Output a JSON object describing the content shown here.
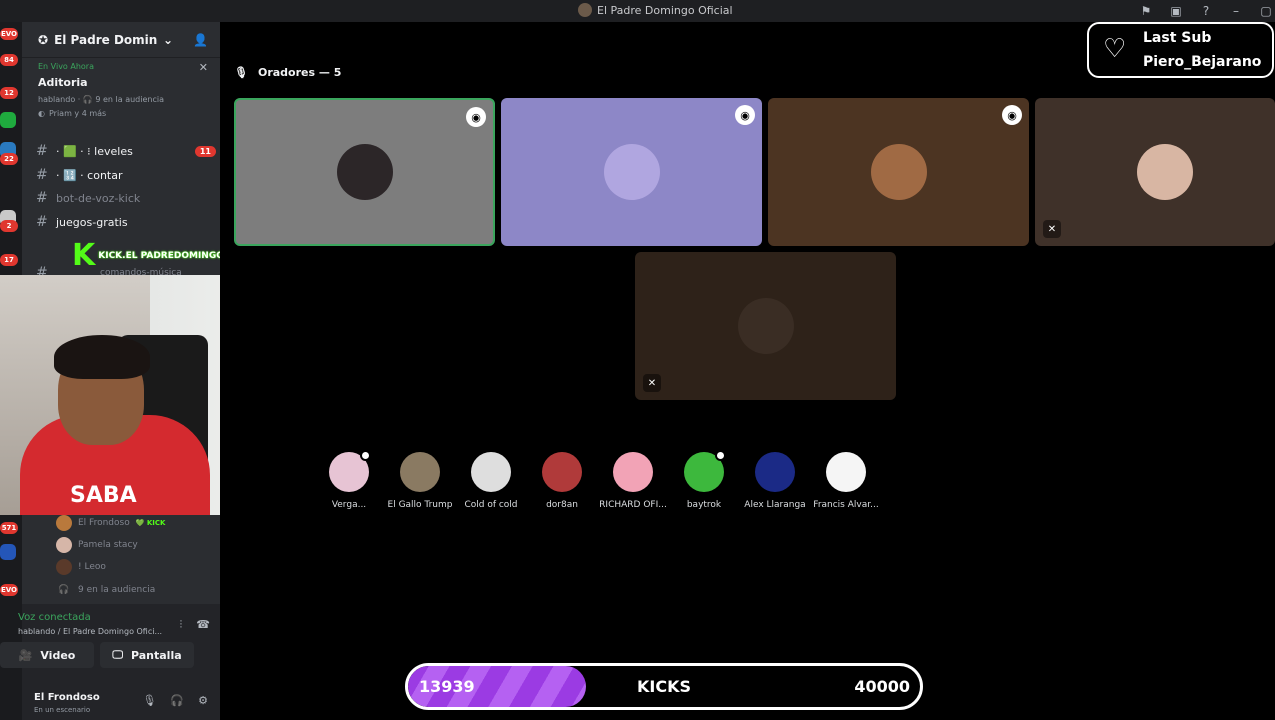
{
  "window": {
    "title": "El Padre Domingo Oficial"
  },
  "titlebar_icons": [
    "flag-icon",
    "inbox-icon",
    "help-icon",
    "minimize-icon",
    "maximize-icon"
  ],
  "rail_badges": [
    "EVO",
    "84",
    "12",
    "22",
    "2",
    "17",
    "571",
    "EVO"
  ],
  "server": {
    "name": "El Padre Domingo O..."
  },
  "live": {
    "tag": "En Vivo Ahora",
    "title": "Aditoria",
    "meta": "hablando · 🎧 9 en la audiencia",
    "people": "Priam y 4 más"
  },
  "channels": [
    {
      "label": "· 🟩 · ⁝ leveles",
      "badge": "11"
    },
    {
      "label": "· 🔢 · contar",
      "badge": ""
    },
    {
      "label": "bot-de-voz-kick",
      "badge": ""
    },
    {
      "label": "juegos-gratis",
      "badge": ""
    },
    {
      "label": "comandos-música",
      "badge": ""
    }
  ],
  "kick_overlay": {
    "letter": "K",
    "handle": "KICK.EL PADREDOMINGOOFICIAL"
  },
  "voice_users": [
    {
      "name": "El Frondoso",
      "tag": "💚 KICK",
      "right": ""
    },
    {
      "name": "Pamela stacy",
      "tag": "",
      "right": "✕"
    },
    {
      "name": "! Leoo",
      "tag": "",
      "right": "✕"
    }
  ],
  "audience_line": "9 en la audiencia",
  "voice_panel": {
    "status": "Voz conectada",
    "sub": "hablando / El Padre Domingo Ofici...",
    "video_label": "Video",
    "screen_label": "Pantalla"
  },
  "user": {
    "name": "El Frondoso",
    "status": "En un escenario"
  },
  "webcam_text": "SABA",
  "speakers": {
    "label": "Oradores — 5"
  },
  "speaker_tiles": [
    {
      "bg": "#7d7d7d",
      "avatar": "#2c2628",
      "stage": true,
      "muted": false,
      "active": true
    },
    {
      "bg": "#8d87c7",
      "avatar": "#b0a6e0",
      "stage": true,
      "muted": false,
      "active": false
    },
    {
      "bg": "#4c3422",
      "avatar": "#a06a44",
      "stage": true,
      "muted": false,
      "active": false
    },
    {
      "bg": "#3f3129",
      "avatar": "#d8b6a3",
      "stage": false,
      "muted": true,
      "active": false
    },
    {
      "bg": "#2e2219",
      "avatar": "#3a2d24",
      "stage": false,
      "muted": true,
      "active": false
    }
  ],
  "audience": [
    {
      "name": "Verga...",
      "color": "#e7c4d4",
      "dot": true
    },
    {
      "name": "El Gallo Trump",
      "color": "#8a7a62",
      "dot": false
    },
    {
      "name": "Cold of cold",
      "color": "#dedede",
      "dot": false
    },
    {
      "name": "dor8an",
      "color": "#b03a3a",
      "dot": false
    },
    {
      "name": "RICHARD OFI...",
      "color": "#f2a3b6",
      "dot": false
    },
    {
      "name": "baytrok",
      "color": "#3db83d",
      "dot": true
    },
    {
      "name": "Alex Llaranga",
      "color": "#1b2a86",
      "dot": false
    },
    {
      "name": "Francis Alvar...",
      "color": "#f5f5f5",
      "dot": false
    }
  ],
  "last_sub": {
    "line1": "Last Sub",
    "line2": "Piero_Bejarano"
  },
  "kicks_goal": {
    "current": "13939",
    "label": "KICKS",
    "max": "40000",
    "progress": 0.348
  },
  "colors": {
    "kick_green": "#53fc18",
    "accent_purple": "#9b3be3",
    "discord_bg": "#2b2d31"
  }
}
